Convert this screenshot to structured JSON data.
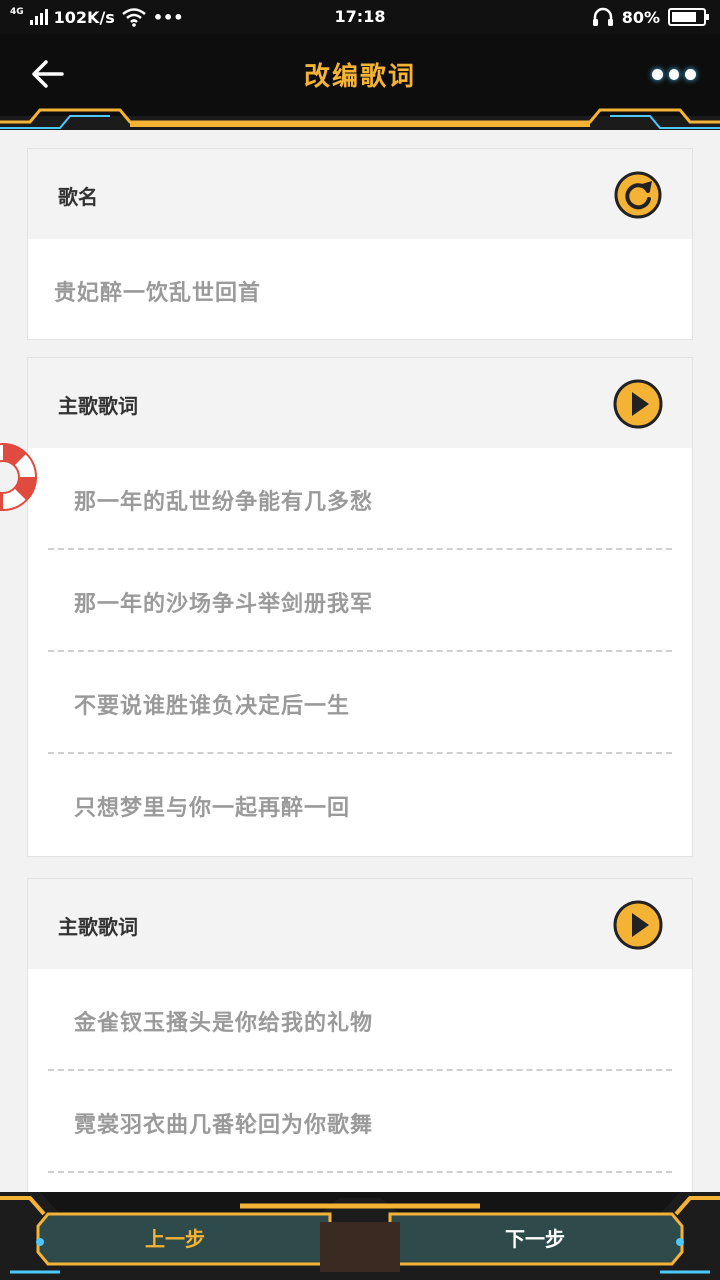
{
  "status_bar": {
    "network": "4G",
    "speed": "102K/s",
    "more": "•••",
    "time": "17:18",
    "battery": "80%",
    "battery_level": 0.8
  },
  "header": {
    "title": "改编歌词",
    "back_icon": "arrow-left-icon",
    "more_icon": "more-dots-icon"
  },
  "song_card": {
    "label": "歌名",
    "refresh_icon": "refresh-icon",
    "value": "贵妃醉一饮乱世回首"
  },
  "sections": [
    {
      "label": "主歌歌词",
      "play_icon": "play-icon",
      "lines": [
        "那一年的乱世纷争能有几多愁",
        "那一年的沙场争斗举剑册我军",
        "不要说谁胜谁负决定后一生",
        "只想梦里与你一起再醉一回"
      ]
    },
    {
      "label": "主歌歌词",
      "play_icon": "play-icon",
      "lines": [
        "金雀钗玉搔头是你给我的礼物",
        "霓裳羽衣曲几番轮回为你歌舞"
      ]
    }
  ],
  "float_icon": "lifebuoy-icon",
  "bottom_bar": {
    "prev_label": "上一步",
    "next_label": "下一步"
  },
  "colors": {
    "accent": "#f5b335",
    "header_bg": "#0d0d0d",
    "lyric_text": "#9a9a9a",
    "bottom_panel": "#2e4a4a"
  }
}
